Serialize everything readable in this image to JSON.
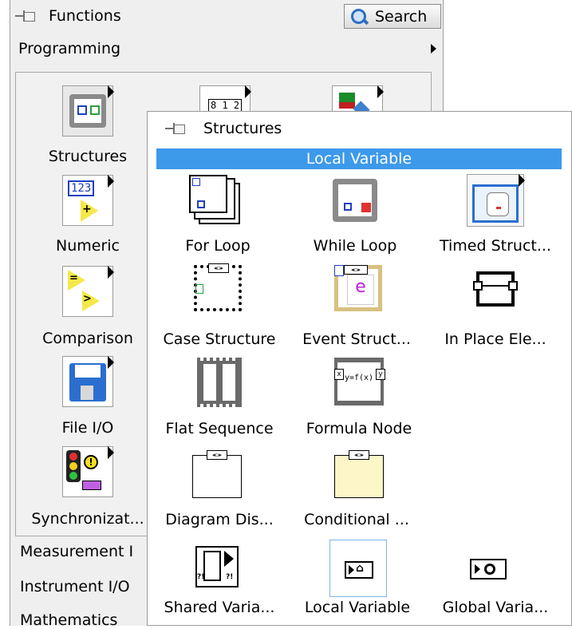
{
  "functions_palette": {
    "title": "Functions",
    "search_label": "Search",
    "category": "Programming",
    "subcategories": [
      {
        "label": "Structures",
        "icon": "structures-icon"
      },
      {
        "label": "Numeric",
        "icon": "numeric-icon",
        "glyph": "123"
      },
      {
        "label": "Comparison",
        "icon": "comparison-icon"
      },
      {
        "label": "File I/O",
        "icon": "file-io-icon"
      },
      {
        "label": "Synchronizat...",
        "icon": "synchronization-icon"
      }
    ],
    "array_icon_text": "8 1 2",
    "more_categories": [
      "Measurement I",
      "Instrument I/O",
      "Mathematics"
    ]
  },
  "structures_palette": {
    "title": "Structures",
    "highlighted_item": "Local Variable",
    "items": [
      {
        "label": "For Loop",
        "icon": "for-loop-icon"
      },
      {
        "label": "While Loop",
        "icon": "while-loop-icon"
      },
      {
        "label": "Timed Struct...",
        "icon": "timed-structure-icon"
      },
      {
        "label": "Case Structure",
        "icon": "case-structure-icon"
      },
      {
        "label": "Event Struct...",
        "icon": "event-structure-icon"
      },
      {
        "label": "In Place Ele...",
        "icon": "in-place-element-icon"
      },
      {
        "label": "Flat Sequence",
        "icon": "flat-sequence-icon"
      },
      {
        "label": "Formula Node",
        "icon": "formula-node-icon"
      },
      {
        "label": "Diagram Dis...",
        "icon": "diagram-disable-icon"
      },
      {
        "label": "Conditional ...",
        "icon": "conditional-disable-icon"
      },
      {
        "label": "Shared Varia...",
        "icon": "shared-variable-icon"
      },
      {
        "label": "Local Variable",
        "icon": "local-variable-icon"
      },
      {
        "label": "Global Varia...",
        "icon": "global-variable-icon"
      }
    ],
    "formula_text": "y=f(x)",
    "event_glyph": "e",
    "colors": {
      "highlight": "#3d99ea",
      "selection_border": "#7eb4ea"
    }
  }
}
